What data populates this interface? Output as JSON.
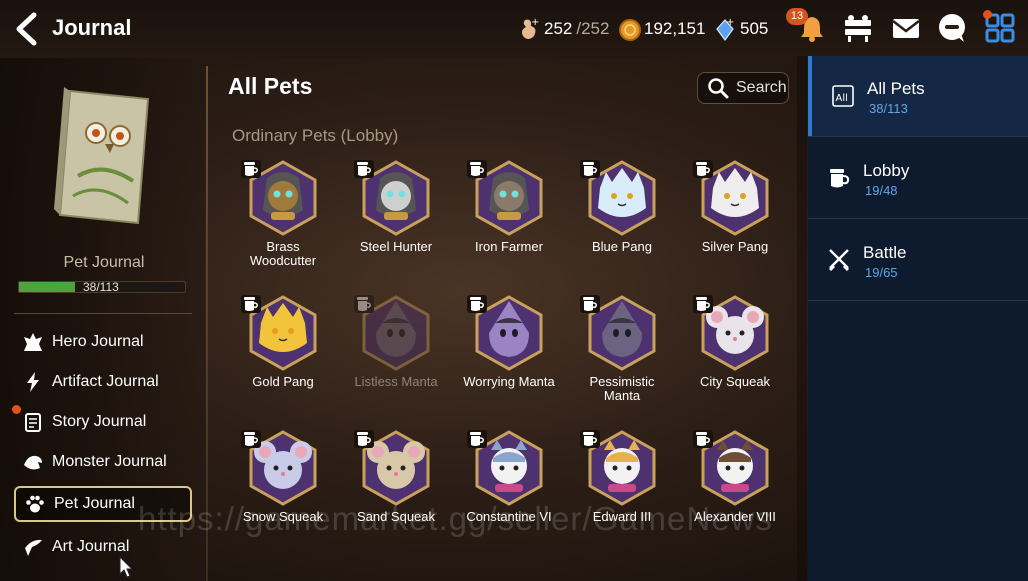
{
  "header": {
    "title": "Journal",
    "stamina": "252",
    "stamina_max": "/252",
    "gold": "192,151",
    "crystals": "505",
    "notification_count": "13"
  },
  "left_panel": {
    "book_title": "Pet Journal",
    "progress_text": "38/113",
    "progress_fraction": 0.336,
    "menu": [
      {
        "label": "Hero Journal",
        "icon": "hero-icon"
      },
      {
        "label": "Artifact Journal",
        "icon": "artifact-icon"
      },
      {
        "label": "Story Journal",
        "icon": "story-icon"
      },
      {
        "label": "Monster Journal",
        "icon": "monster-icon"
      },
      {
        "label": "Pet Journal",
        "icon": "paw-icon"
      },
      {
        "label": "Art Journal",
        "icon": "art-icon"
      }
    ]
  },
  "main": {
    "title": "All Pets",
    "search_label": "Search",
    "section_title": "Ordinary Pets (Lobby)",
    "pets": [
      {
        "line1": "Brass",
        "line2": "Woodcutter",
        "kind": "robot",
        "color": "#a07a3a"
      },
      {
        "line1": "Steel Hunter",
        "line2": "",
        "kind": "robot",
        "color": "#cfcfcf"
      },
      {
        "line1": "Iron Farmer",
        "line2": "",
        "kind": "robot",
        "color": "#8c7a68"
      },
      {
        "line1": "Blue Pang",
        "line2": "",
        "kind": "pang",
        "color": "#d9ecfa"
      },
      {
        "line1": "Silver Pang",
        "line2": "",
        "kind": "pang",
        "color": "#eeeeee"
      },
      {
        "line1": "Gold Pang",
        "line2": "",
        "kind": "pang",
        "color": "#f2c43c"
      },
      {
        "line1": "Listless Manta",
        "line2": "",
        "kind": "manta",
        "color": "#7a6a88"
      },
      {
        "line1": "Worrying Manta",
        "line2": "",
        "kind": "manta",
        "color": "#9a84c4"
      },
      {
        "line1": "Pessimistic",
        "line2": "Manta",
        "kind": "manta",
        "color": "#6a6480"
      },
      {
        "line1": "City Squeak",
        "line2": "",
        "kind": "squeak",
        "color": "#e8e4ea"
      },
      {
        "line1": "Snow Squeak",
        "line2": "",
        "kind": "squeak",
        "color": "#c8cce8"
      },
      {
        "line1": "Sand Squeak",
        "line2": "",
        "kind": "squeak",
        "color": "#d8c8a8"
      },
      {
        "line1": "Constantine VI",
        "line2": "",
        "kind": "cat",
        "color": "#8aa6c8"
      },
      {
        "line1": "Edward III",
        "line2": "",
        "kind": "cat",
        "color": "#e6b24a"
      },
      {
        "line1": "Alexander VIII",
        "line2": "",
        "kind": "cat",
        "color": "#6e4e34"
      }
    ]
  },
  "right_panel": {
    "tabs": [
      {
        "label": "All Pets",
        "count": "38/113",
        "icon": "all-icon"
      },
      {
        "label": "Lobby",
        "count": "19/48",
        "icon": "lobby-icon"
      },
      {
        "label": "Battle",
        "count": "19/65",
        "icon": "battle-icon"
      }
    ]
  },
  "watermark": "https://gamemarket.gg/seller/GameNews",
  "colors": {
    "accent_blue": "#2d7ad2",
    "progress_green": "#4aa53a",
    "badge_orange": "#d8531e",
    "active_outline": "#d7c88c"
  }
}
